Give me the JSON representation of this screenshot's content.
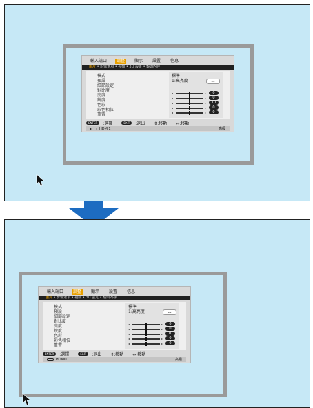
{
  "colors": {
    "screen_bg": "#c6e8f6",
    "frame": "#9a9a9a",
    "arrow": "#1d6cc1",
    "accent": "#e8a000"
  },
  "osd": {
    "tabs": [
      "輸入端口",
      "調整",
      "顯示",
      "設置",
      "信息"
    ],
    "active_tab": "調整",
    "subnav": {
      "first": "圖片",
      "rest": " • 影像選項 • 視頻 • 3D 設定 • 鏡頭內存"
    },
    "labels": [
      "模式",
      "預設",
      "細節設定",
      "對比度",
      "亮度",
      "銳度",
      "色彩",
      "彩色相位",
      "重置"
    ],
    "mode_value": "標準",
    "preset_value": "1:高亮度",
    "stepper_icon": "left-right-arrows-icon",
    "sliders": [
      {
        "label": "對比度",
        "value": "0",
        "level": 0.5
      },
      {
        "label": "亮度",
        "value": "0",
        "level": 0.5
      },
      {
        "label": "銳度",
        "value": "10",
        "level": 0.5
      },
      {
        "label": "色彩",
        "value": "0",
        "level": 0.5
      },
      {
        "label": "彩色相位",
        "value": "0",
        "level": 0.5
      }
    ],
    "footer": {
      "enter_key": "ENTER",
      "enter_action": ":選擇",
      "exit_key": "EXIT",
      "exit_action": ":退出",
      "move": "⇕:移動",
      "move2": "⇔:移動"
    },
    "status": {
      "source": "HDMI1",
      "mode": "高級"
    }
  }
}
